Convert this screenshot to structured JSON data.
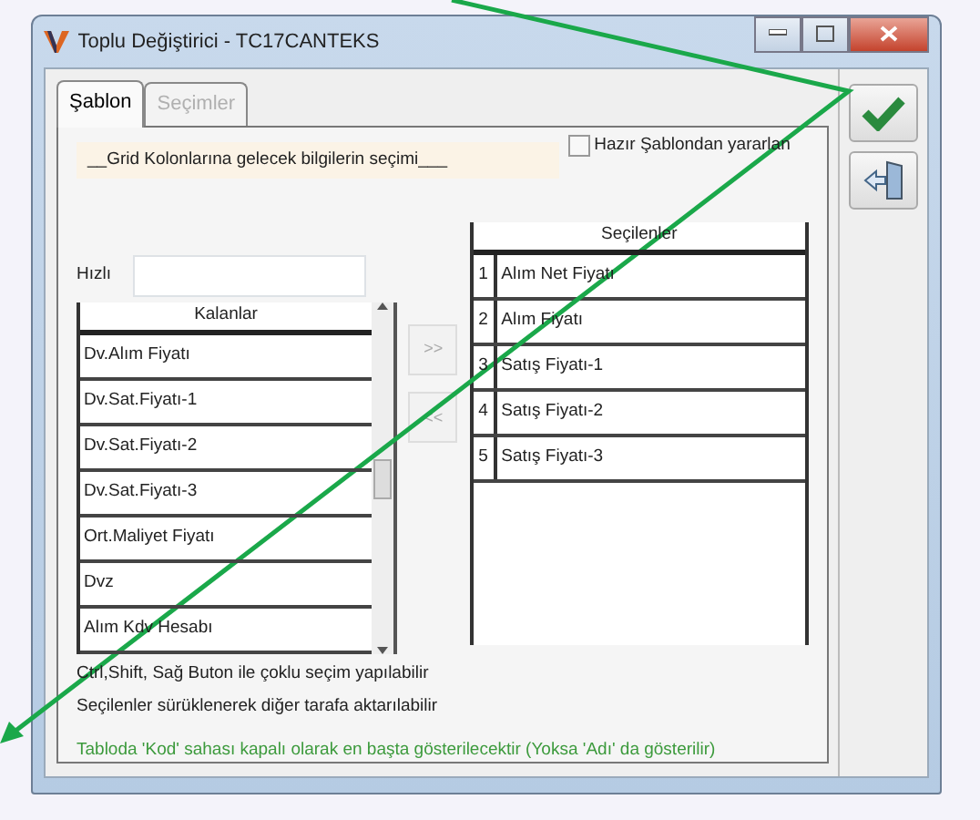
{
  "window": {
    "title": "Toplu Değiştirici - TC17CANTEKS"
  },
  "tabs": [
    {
      "label": "Şablon",
      "selected": true,
      "disabled": false
    },
    {
      "label": "Seçimler",
      "selected": false,
      "disabled": true
    }
  ],
  "banner": "__Grid Kolonlarına gelecek bilgilerin seçimi___",
  "template_checkbox": {
    "label": "Hazır Şablondan yararlan",
    "checked": false
  },
  "quick_search": {
    "label": "Hızlı"
  },
  "remaining": {
    "header": "Kalanlar",
    "rows": [
      "Dv.Alım Fiyatı",
      "Dv.Sat.Fiyatı-1",
      "Dv.Sat.Fiyatı-2",
      "Dv.Sat.Fiyatı-3",
      "Ort.Maliyet Fiyatı",
      "Dvz",
      "Alım Kdv Hesabı"
    ]
  },
  "move_buttons": [
    ">>",
    "<<"
  ],
  "selected_list": {
    "header": "Seçilenler",
    "rows": [
      {
        "number": "1",
        "name": "Alım Net Fiyatı"
      },
      {
        "number": "2",
        "name": "Alım Fiyatı"
      },
      {
        "number": "3",
        "name": "Satış Fiyatı-1"
      },
      {
        "number": "4",
        "name": "Satış Fiyatı-2"
      },
      {
        "number": "5",
        "name": "Satış Fiyatı-3"
      }
    ]
  },
  "hints": [
    {
      "text": "Ctrl,Shift, Sağ Buton ile çoklu seçim yapılabilir",
      "kind": "plain"
    },
    {
      "text": "Seçilenler sürüklenerek diğer tarafa aktarılabilir",
      "kind": "plain"
    },
    {
      "text": "Tabloda 'Kod' sahası kapalı olarak en başta gösterilecektir (Yoksa 'Adı' da gösterilir)",
      "kind": "note"
    }
  ]
}
